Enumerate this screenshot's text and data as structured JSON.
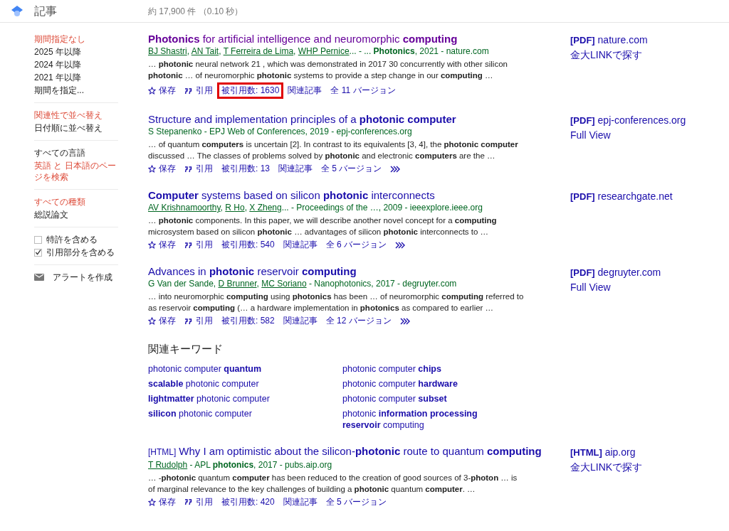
{
  "header": {
    "title": "記事",
    "stats": "約 17,900 件 （0.10 秒）"
  },
  "sidebar": {
    "groups": [
      {
        "items": [
          {
            "kind": "link",
            "label": "期間指定なし",
            "selected": true
          },
          {
            "kind": "link",
            "label": "2025 年以降",
            "selected": false
          },
          {
            "kind": "link",
            "label": "2024 年以降",
            "selected": false
          },
          {
            "kind": "link",
            "label": "2021 年以降",
            "selected": false
          },
          {
            "kind": "link",
            "label": "期間を指定...",
            "selected": false
          }
        ]
      },
      {
        "items": [
          {
            "kind": "link",
            "label": "関連性で並べ替え",
            "selected": true
          },
          {
            "kind": "link",
            "label": "日付順に並べ替え",
            "selected": false
          }
        ]
      },
      {
        "items": [
          {
            "kind": "link",
            "label": "すべての言語",
            "selected": false
          },
          {
            "kind": "link",
            "label": "英語 と 日本語のページを検索",
            "selected": true
          }
        ]
      },
      {
        "items": [
          {
            "kind": "link",
            "label": "すべての種類",
            "selected": true
          },
          {
            "kind": "link",
            "label": "総説論文",
            "selected": false
          }
        ]
      },
      {
        "items": [
          {
            "kind": "checkbox",
            "label": "特許を含める",
            "checked": false
          },
          {
            "kind": "checkbox",
            "label": "引用部分を含める",
            "checked": true
          }
        ]
      },
      {
        "items": [
          {
            "kind": "alert",
            "label": "アラートを作成"
          }
        ]
      }
    ]
  },
  "results": [
    {
      "title": "**Photonics** for artificial intelligence and neuromorphic **computing**",
      "visited": true,
      "byline": [
        {
          "text": "BJ Shastri",
          "linked": true
        },
        {
          "text": ", ",
          "linked": false
        },
        {
          "text": "AN Tait",
          "linked": true
        },
        {
          "text": ", ",
          "linked": false
        },
        {
          "text": "T Ferreira de Lima",
          "linked": true
        },
        {
          "text": ", ",
          "linked": false
        },
        {
          "text": "WHP Pernice",
          "linked": true
        },
        {
          "text": "... - ... **Photonics**, 2021 - nature.com",
          "linked": false
        }
      ],
      "snippet": "… **photonic** neural network 21 , which was demonstrated in 2017 30 concurrently with other silicon **photonic** … of neuromorphic **photonic** systems to provide a step change in our **computing** …",
      "actions": {
        "save": "保存",
        "cite": "引用",
        "cited_by": "被引用数: 1630",
        "related": "関連記事",
        "versions": "全 11 バージョン",
        "cited_highlighted": true,
        "more": false
      },
      "side": {
        "prefix": "[PDF]",
        "domain": "nature.com",
        "extra": "金大LINKで探す"
      }
    },
    {
      "title": "Structure and implementation principles of a **photonic computer**",
      "visited": false,
      "byline": [
        {
          "text": "S Stepanenko - EPJ Web of Conferences, 2019 - epj-conferences.org",
          "linked": false
        }
      ],
      "snippet": "… of quantum **computers** is uncertain [2]. In contrast to its equivalents [3, 4], the **photonic computer** discussed … The classes of problems solved by **photonic** and electronic **computers** are the …",
      "actions": {
        "save": "保存",
        "cite": "引用",
        "cited_by": "被引用数: 13",
        "related": "関連記事",
        "versions": "全 5 バージョン",
        "cited_highlighted": false,
        "more": true
      },
      "side": {
        "prefix": "[PDF]",
        "domain": "epj-conferences.org",
        "extra": "Full View"
      }
    },
    {
      "title": "**Computer** systems based on silicon **photonic** interconnects",
      "visited": false,
      "byline": [
        {
          "text": "AV Krishnamoorthy",
          "linked": true
        },
        {
          "text": ", ",
          "linked": false
        },
        {
          "text": "R Ho",
          "linked": true
        },
        {
          "text": ", ",
          "linked": false
        },
        {
          "text": "X Zheng",
          "linked": true
        },
        {
          "text": "... - Proceedings of the …, 2009 - ieeexplore.ieee.org",
          "linked": false
        }
      ],
      "snippet": "… **photonic** components. In this paper, we will describe another novel concept for a **computing** microsystem based on silicon **photonic** … advantages of silicon **photonic** interconnects to …",
      "actions": {
        "save": "保存",
        "cite": "引用",
        "cited_by": "被引用数: 540",
        "related": "関連記事",
        "versions": "全 6 バージョン",
        "cited_highlighted": false,
        "more": true
      },
      "side": {
        "prefix": "[PDF]",
        "domain": "researchgate.net"
      }
    },
    {
      "title": "Advances in **photonic** reservoir **computing**",
      "visited": false,
      "byline": [
        {
          "text": "G Van der Sande, ",
          "linked": false
        },
        {
          "text": "D Brunner",
          "linked": true
        },
        {
          "text": ", ",
          "linked": false
        },
        {
          "text": "MC Soriano",
          "linked": true
        },
        {
          "text": " - Nanophotonics, 2017 - degruyter.com",
          "linked": false
        }
      ],
      "snippet": "… into neuromorphic **computing** using **photonics** has been … of neuromorphic **computing** referred to as reservoir **computing** (… a hardware implementation in **photonics** as compared to earlier …",
      "actions": {
        "save": "保存",
        "cite": "引用",
        "cited_by": "被引用数: 582",
        "related": "関連記事",
        "versions": "全 12 バージョン",
        "cited_highlighted": false,
        "more": true
      },
      "side": {
        "prefix": "[PDF]",
        "domain": "degruyter.com",
        "extra": "Full View"
      }
    }
  ],
  "related_keywords": {
    "heading": "関連キーワード",
    "items": [
      "photonic computer **quantum**",
      "photonic computer **chips**",
      "**scalable** photonic computer",
      "photonic computer **hardware**",
      "**lightmatter** photonic computer",
      "photonic computer **subset**",
      "**silicon** photonic computer",
      "photonic **information processing reservoir** computing"
    ]
  },
  "results_after": [
    {
      "prefix": "[HTML]",
      "title": "Why I am optimistic about the silicon-**photonic** route to quantum **computing**",
      "visited": false,
      "byline": [
        {
          "text": "T Rudolph",
          "linked": true
        },
        {
          "text": " - APL **photonics**, 2017 - pubs.aip.org",
          "linked": false
        }
      ],
      "snippet": "… -**photonic** quantum **computer** has been reduced to the creation of good sources of 3-**photon** … is of marginal relevance to the key challenges of building a **photonic** quantum **computer**. …",
      "actions": {
        "save": "保存",
        "cite": "引用",
        "cited_by": "被引用数: 420",
        "related": "関連記事",
        "versions": "全 5 バージョン",
        "cited_highlighted": false,
        "more": false
      },
      "side": {
        "prefix": "[HTML]",
        "domain": "aip.org",
        "extra": "金大LINKで探す"
      }
    }
  ]
}
